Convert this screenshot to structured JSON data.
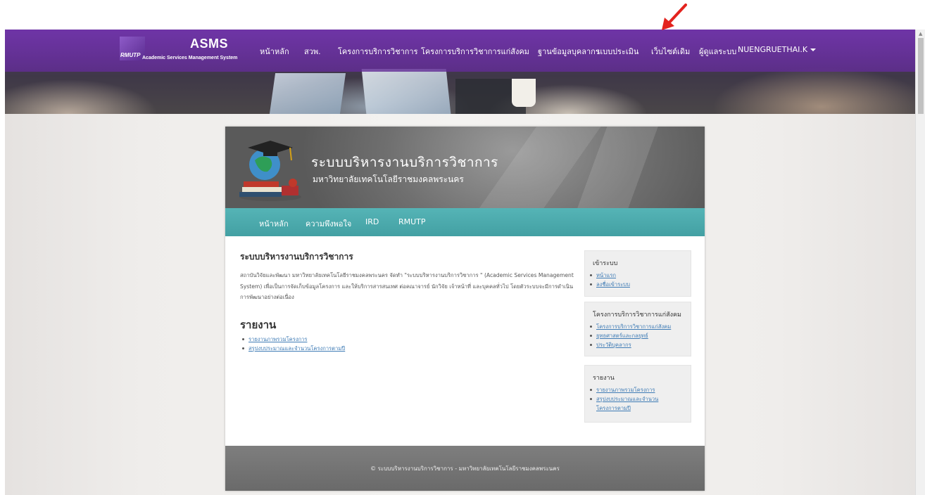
{
  "header": {
    "logo_text": "RMUTP",
    "brand": "ASMS",
    "brand_sub": "Academic Services Management System",
    "nav": [
      {
        "label": "หน้าหลัก"
      },
      {
        "label": "สวพ."
      },
      {
        "label": "โครงการบริการวิชาการ"
      },
      {
        "label": "โครงการบริการวิชาการแก่สังคม"
      },
      {
        "label": "ฐานข้อมูลบุคลากร"
      },
      {
        "label": "แบบประเมิน"
      },
      {
        "label": "เว็บไซต์เดิม"
      },
      {
        "label": "ผู้ดูแลระบบ"
      },
      {
        "label": "NUENGRUETHAI.K"
      }
    ]
  },
  "site": {
    "title": "ระบบบริหารงานบริการวิชาการ",
    "subtitle": "มหาวิทยาลัยเทคโนโลยีราชมงคลพระนคร",
    "nav": [
      {
        "label": "หน้าหลัก"
      },
      {
        "label": "ความพึงพอใจ"
      },
      {
        "label": "IRD"
      },
      {
        "label": "RMUTP"
      }
    ]
  },
  "main": {
    "title": "ระบบบริหารงานบริการวิชาการ",
    "description": "สถาบันวิจัยและพัฒนา มหาวิทยาลัยเทคโนโลยีราชมงคลพระนคร จัดทำ \"ระบบบริหารงานบริการวิชาการ \" (Academic Services Management System) เพื่อเป็นการจัดเก็บข้อมูลโครงการ และให้บริการสารสนเทศ ต่อคณาจารย์ นักวิจัย เจ้าหน้าที่ และบุคคลทั่วไป โดยตัวระบบจะมีการดำเนินการพัฒนาอย่างต่อเนื่อง",
    "report_heading": "รายงาน",
    "report_links": [
      {
        "label": "รายงานภาพรวมโครงการ"
      },
      {
        "label": "สรุปงบประมาณและจำนวนโครงการตามปี"
      }
    ]
  },
  "sidebar": {
    "login": {
      "title": "เข้าระบบ",
      "links": [
        {
          "label": "หน้าแรก"
        },
        {
          "label": "ลงชื่อเข้าระบบ"
        }
      ]
    },
    "projects": {
      "title": "โครงการบริการวิชาการแก่สังคม",
      "links": [
        {
          "label": "โครงการบริการวิชาการแก่สังคม"
        },
        {
          "label": "ยุทธศาสตร์และกลยุทธ์"
        },
        {
          "label": "ประวัติบุคลากร"
        }
      ]
    },
    "reports": {
      "title": "รายงาน",
      "links": [
        {
          "label": "รายงานภาพรวมโครงการ"
        },
        {
          "label": "สรุปงบประมาณและจำนวนโครงการตามปี"
        }
      ]
    }
  },
  "footer": {
    "text": "© ระบบบริหารงานบริการวิชาการ - มหาวิทยาลัยเทคโนโลยีราชมงคลพระนคร"
  },
  "colors": {
    "header_purple": "#6f35a8",
    "nav_teal": "#4aa9ab",
    "link_blue": "#3e7bb5",
    "annotation_red": "#e3231e"
  }
}
